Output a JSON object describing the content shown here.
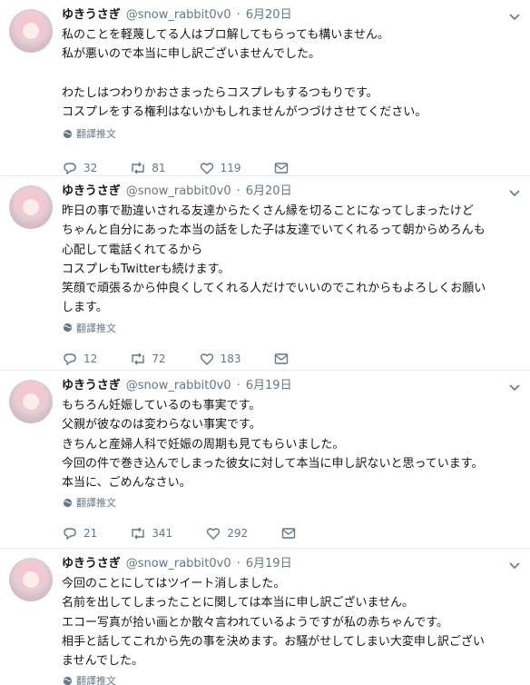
{
  "tweets": [
    {
      "name": "ゆきうさぎ",
      "handle": "@snow_rabbit0v0",
      "date": "6月20日",
      "lines": [
        "私のことを軽蔑してる人はブロ解してもらっても構いません。",
        "私が悪いので本当に申し訳ございませんでした。",
        "",
        "わたしはつわりかおさまったらコスプレもするつもりです。",
        "コスプレをする権利はないかもしれませんがつづけさせてください。"
      ],
      "translate_label": "翻譯推文",
      "replies": "32",
      "retweets": "81",
      "likes": "119"
    },
    {
      "name": "ゆきうさぎ",
      "handle": "@snow_rabbit0v0",
      "date": "6月20日",
      "lines": [
        "昨日の事で勘違いされる友達からたくさん縁を切ることになってしまったけど",
        "ちゃんと自分にあった本当の話をした子は友達でいてくれるって朝からめろんも",
        "心配して電話くれてるから",
        "コスプレもTwitterも続けます。",
        "笑顔で頑張るから仲良くしてくれる人だけでいいのでこれからもよろしくお願い",
        "します。"
      ],
      "translate_label": "翻譯推文",
      "replies": "12",
      "retweets": "72",
      "likes": "183"
    },
    {
      "name": "ゆきうさぎ",
      "handle": "@snow_rabbit0v0",
      "date": "6月19日",
      "lines": [
        "もちろん妊娠しているのも事実です。",
        "父親が彼なのは変わらない事実です。",
        "きちんと産婦人科で妊娠の周期も見てもらいました。",
        "今回の件で巻き込んでしまった彼女に対して本当に申し訳ないと思っています。",
        "本当に、ごめんなさい。"
      ],
      "translate_label": "翻譯推文",
      "replies": "21",
      "retweets": "341",
      "likes": "292"
    },
    {
      "name": "ゆきうさぎ",
      "handle": "@snow_rabbit0v0",
      "date": "6月19日",
      "lines": [
        "今回のことにしてはツイート消しました。",
        "名前を出してしまったことに関しては本当に申し訳ございません。",
        "エコー写真が拾い画とか散々言われているようですが私の赤ちゃんです。",
        "相手と話してこれから先の事を決めます。お騒がせしてしまい大変申し訳ござい",
        "ませんでした。"
      ],
      "translate_label": "翻譯推文"
    }
  ],
  "colors": {
    "text": "#14171a",
    "secondary": "#657786",
    "border": "#e6ecf0"
  },
  "icons": [
    "caret-down-icon",
    "globe-icon",
    "reply-icon",
    "retweet-icon",
    "like-icon",
    "message-icon"
  ]
}
